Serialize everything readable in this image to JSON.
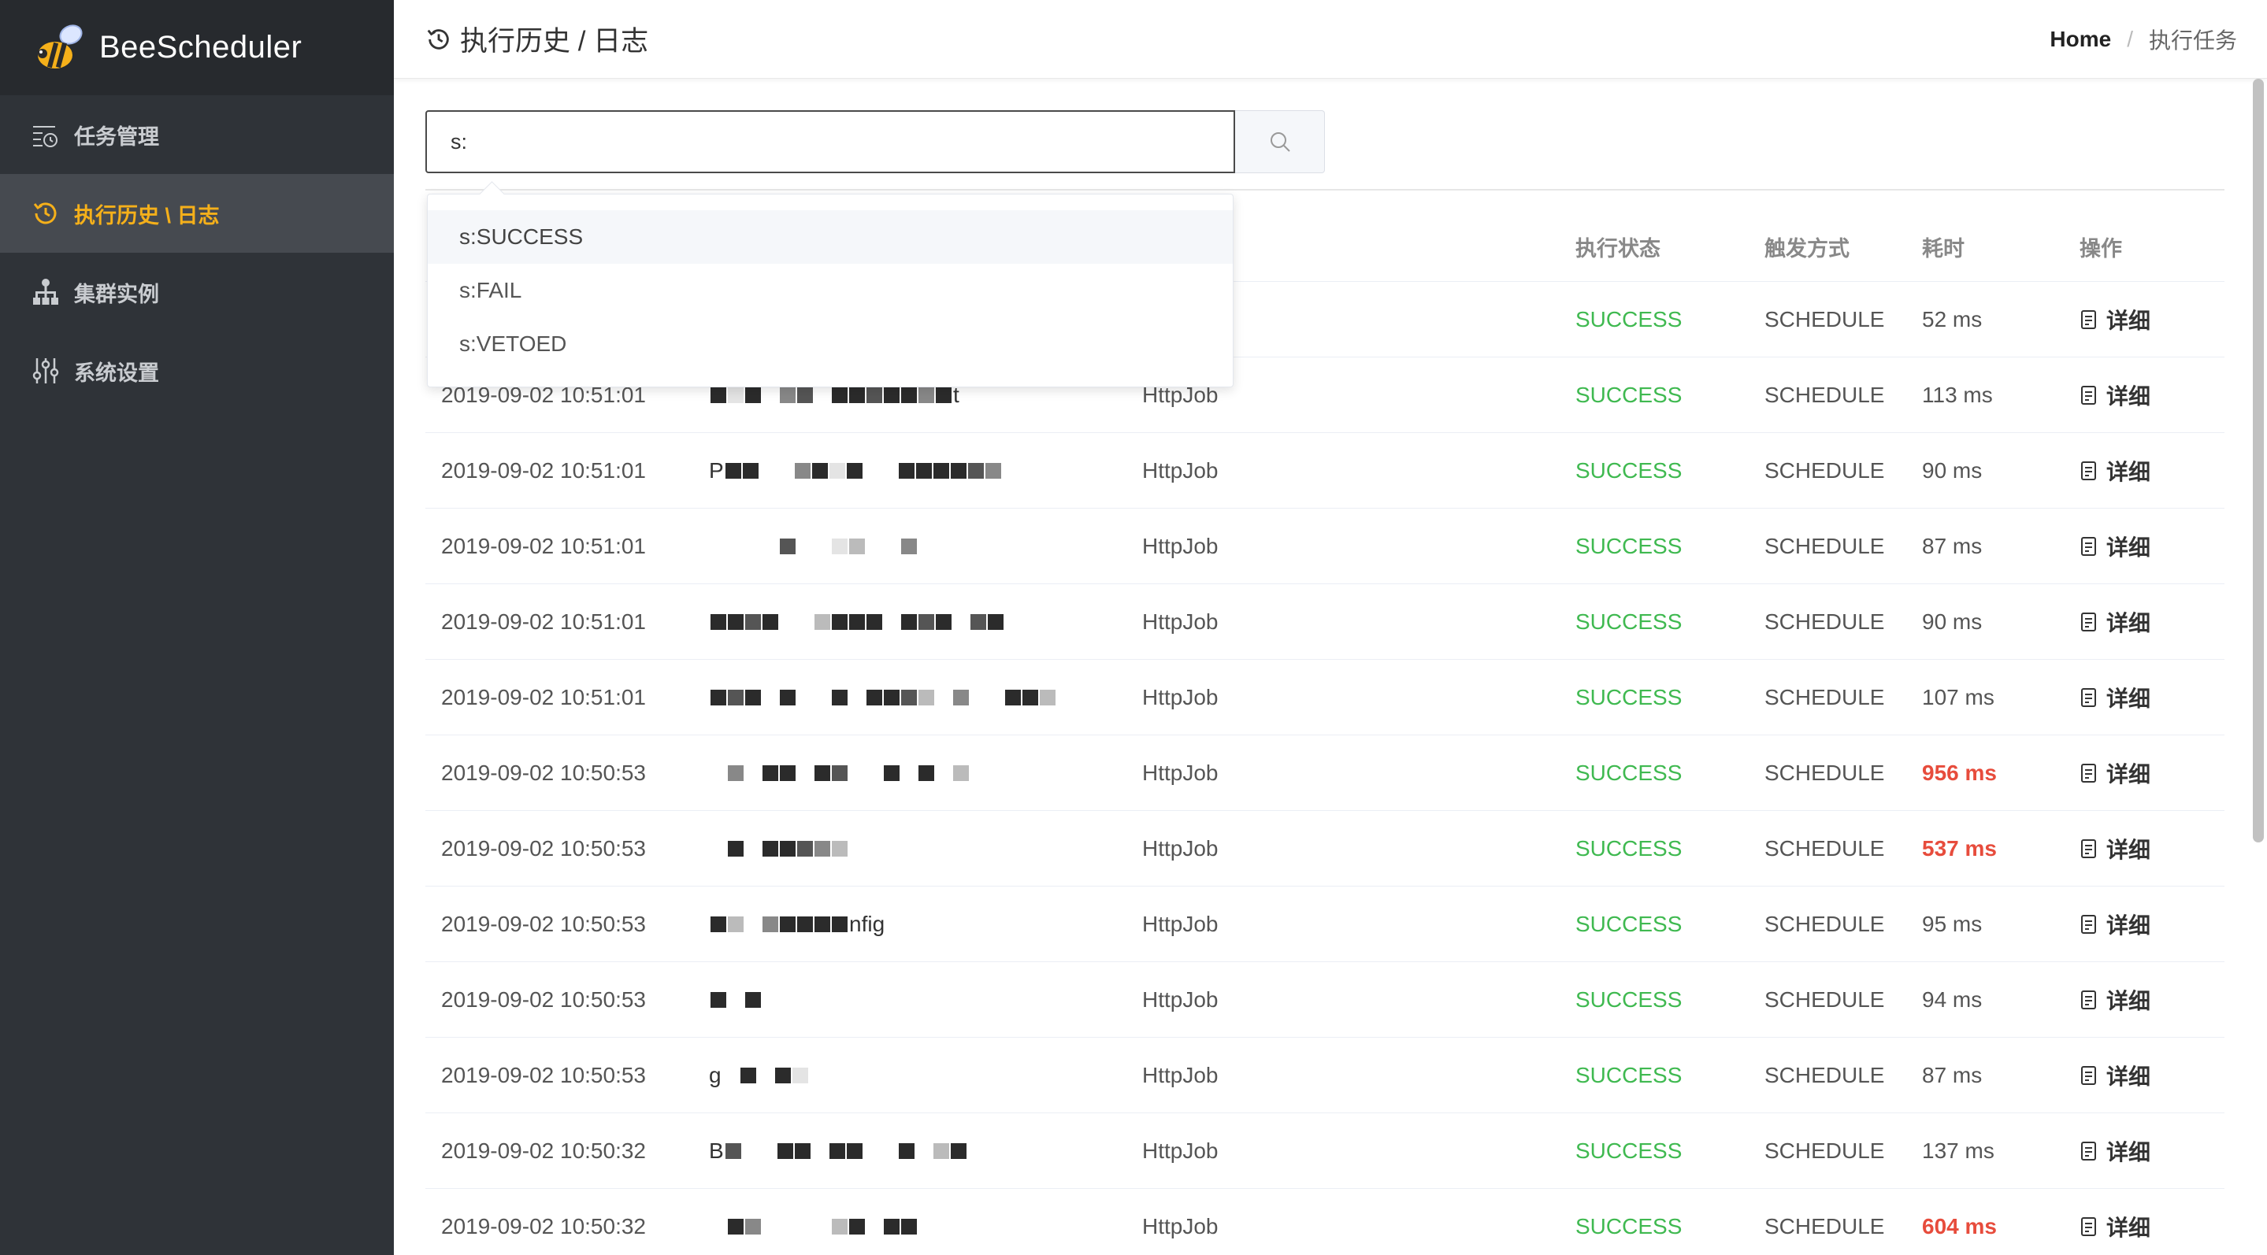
{
  "brand": {
    "name": "BeeScheduler"
  },
  "sidebar": {
    "items": [
      {
        "label": "任务管理",
        "icon": "task-list-icon",
        "active": false
      },
      {
        "label": "执行历史 \\ 日志",
        "icon": "history-icon",
        "active": true
      },
      {
        "label": "集群实例",
        "icon": "cluster-icon",
        "active": false
      },
      {
        "label": "系统设置",
        "icon": "settings-sliders-icon",
        "active": false
      }
    ]
  },
  "header": {
    "title": "执行历史 / 日志",
    "breadcrumb": {
      "home": "Home",
      "separator": "/",
      "current": "执行任务"
    }
  },
  "search": {
    "value": "s:",
    "placeholder": ""
  },
  "suggestions": [
    "s:SUCCESS",
    "s:FAIL",
    "s:VETOED"
  ],
  "table": {
    "columns": {
      "status": "执行状态",
      "trigger": "触发方式",
      "cost": "耗时",
      "op": "操作"
    },
    "detail_label": "详细",
    "rows": [
      {
        "time": "",
        "name_prefix": "",
        "type": "",
        "status": "SUCCESS",
        "trigger": "SCHEDULE",
        "cost": "52 ms",
        "slow": false
      },
      {
        "time": "2019-09-02 10:51:01",
        "name_prefix": "",
        "name_suffix": "t",
        "type": "HttpJob",
        "status": "SUCCESS",
        "trigger": "SCHEDULE",
        "cost": "113 ms",
        "slow": false
      },
      {
        "time": "2019-09-02 10:51:01",
        "name_prefix": "P",
        "type": "HttpJob",
        "status": "SUCCESS",
        "trigger": "SCHEDULE",
        "cost": "90 ms",
        "slow": false
      },
      {
        "time": "2019-09-02 10:51:01",
        "name_prefix": "",
        "type": "HttpJob",
        "status": "SUCCESS",
        "trigger": "SCHEDULE",
        "cost": "87 ms",
        "slow": false
      },
      {
        "time": "2019-09-02 10:51:01",
        "name_prefix": "",
        "type": "HttpJob",
        "status": "SUCCESS",
        "trigger": "SCHEDULE",
        "cost": "90 ms",
        "slow": false
      },
      {
        "time": "2019-09-02 10:51:01",
        "name_prefix": "",
        "type": "HttpJob",
        "status": "SUCCESS",
        "trigger": "SCHEDULE",
        "cost": "107 ms",
        "slow": false
      },
      {
        "time": "2019-09-02 10:50:53",
        "name_prefix": "",
        "type": "HttpJob",
        "status": "SUCCESS",
        "trigger": "SCHEDULE",
        "cost": "956 ms",
        "slow": true
      },
      {
        "time": "2019-09-02 10:50:53",
        "name_prefix": "",
        "type": "HttpJob",
        "status": "SUCCESS",
        "trigger": "SCHEDULE",
        "cost": "537 ms",
        "slow": true
      },
      {
        "time": "2019-09-02 10:50:53",
        "name_prefix": "",
        "name_suffix": "nfig",
        "type": "HttpJob",
        "status": "SUCCESS",
        "trigger": "SCHEDULE",
        "cost": "95 ms",
        "slow": false
      },
      {
        "time": "2019-09-02 10:50:53",
        "name_prefix": "",
        "type": "HttpJob",
        "status": "SUCCESS",
        "trigger": "SCHEDULE",
        "cost": "94 ms",
        "slow": false
      },
      {
        "time": "2019-09-02 10:50:53",
        "name_prefix": "g",
        "type": "HttpJob",
        "status": "SUCCESS",
        "trigger": "SCHEDULE",
        "cost": "87 ms",
        "slow": false
      },
      {
        "time": "2019-09-02 10:50:32",
        "name_prefix": "B",
        "type": "HttpJob",
        "status": "SUCCESS",
        "trigger": "SCHEDULE",
        "cost": "137 ms",
        "slow": false
      },
      {
        "time": "2019-09-02 10:50:32",
        "name_prefix": "",
        "type": "HttpJob",
        "status": "SUCCESS",
        "trigger": "SCHEDULE",
        "cost": "604 ms",
        "slow": true
      }
    ]
  },
  "colors": {
    "sidebar_bg": "#2f3338",
    "active_accent": "#f5b01a",
    "success": "#3fb950",
    "slow": "#e74c3c"
  }
}
